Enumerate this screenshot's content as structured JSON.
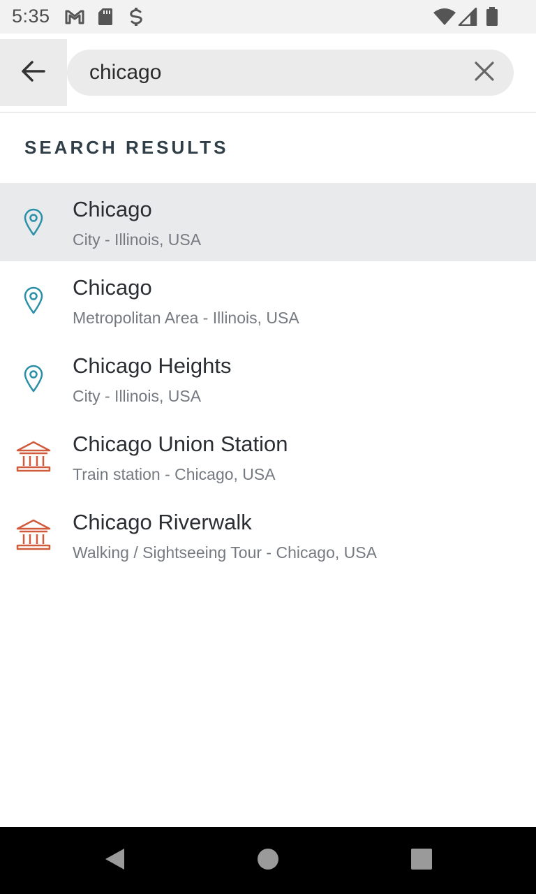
{
  "status_bar": {
    "time": "5:35",
    "left_icons": [
      "gmail-icon",
      "sd-card-icon",
      "sync-icon"
    ],
    "right_icons": [
      "wifi-icon",
      "cell-signal-icon",
      "battery-icon"
    ]
  },
  "search": {
    "query": "chicago",
    "back_icon": "arrow-left-icon",
    "clear_icon": "close-icon"
  },
  "section": {
    "header": "SEARCH RESULTS"
  },
  "colors": {
    "pin": "#2a8fa8",
    "landmark": "#cf5a3c",
    "highlight": "#e9eaec"
  },
  "results": [
    {
      "title": "Chicago",
      "subtitle": "City - Illinois, USA",
      "icon": "map-pin-icon",
      "highlighted": true
    },
    {
      "title": "Chicago",
      "subtitle": "Metropolitan Area - Illinois, USA",
      "icon": "map-pin-icon",
      "highlighted": false
    },
    {
      "title": "Chicago Heights",
      "subtitle": "City - Illinois, USA",
      "icon": "map-pin-icon",
      "highlighted": false
    },
    {
      "title": "Chicago Union Station",
      "subtitle": "Train station - Chicago, USA",
      "icon": "landmark-icon",
      "highlighted": false
    },
    {
      "title": "Chicago Riverwalk",
      "subtitle": "Walking / Sightseeing Tour - Chicago, USA",
      "icon": "landmark-icon",
      "highlighted": false
    }
  ],
  "nav_bar": {
    "buttons": [
      "back-triangle-icon",
      "home-circle-icon",
      "recents-square-icon"
    ]
  }
}
